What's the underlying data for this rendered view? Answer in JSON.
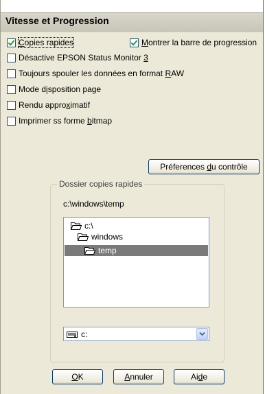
{
  "dialog": {
    "title": "Vitesse et Progression"
  },
  "options": [
    {
      "label_pre": "",
      "label_u": "C",
      "label_post": "opies rapides",
      "checked": true
    },
    {
      "label_pre": "",
      "label_u": "M",
      "label_post": "ontrer la barre de progression",
      "checked": true
    },
    {
      "label_pre": "Désactive EPSON Status Monitor ",
      "label_u": "3",
      "label_post": "",
      "checked": false
    },
    {
      "label_pre": "Toujours spouler les données en format ",
      "label_u": "R",
      "label_post": "AW",
      "checked": false
    },
    {
      "label_pre": "Mode d",
      "label_u": "i",
      "label_post": "sposition page",
      "checked": false
    },
    {
      "label_pre": "Rendu appro",
      "label_u": "x",
      "label_post": "imatif",
      "checked": false
    },
    {
      "label_pre": "Imprimer ss forme ",
      "label_u": "b",
      "label_post": "itmap",
      "checked": false
    }
  ],
  "monitor_button": {
    "label_pre": "Préferences ",
    "label_u": "d",
    "label_post": "u contrôle"
  },
  "spool_folder": {
    "group_title": "Dossier copies rapides",
    "current_path": "c:\\windows\\temp",
    "tree": [
      {
        "label": "c:\\",
        "selected": false,
        "icon": "open-folder-icon"
      },
      {
        "label": "windows",
        "selected": false,
        "icon": "open-folder-icon"
      },
      {
        "label": "temp",
        "selected": true,
        "icon": "open-folder-icon"
      }
    ],
    "drive": {
      "value": "c:",
      "icon": "hard-drive-icon"
    }
  },
  "footer": {
    "ok_u": "O",
    "ok_post": "K",
    "cancel_u": "A",
    "cancel_post": "nnuler",
    "help_pre": "Ai",
    "help_u": "d",
    "help_post": "e"
  }
}
